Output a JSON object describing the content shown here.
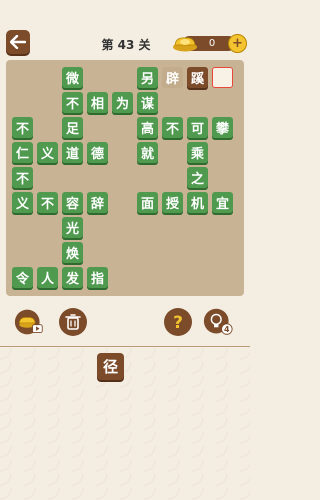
{
  "header": {
    "title": "第 43 关",
    "coin_count": "0",
    "plus_label": "+"
  },
  "board": {
    "cells": [
      {
        "ch": "微",
        "col": 2,
        "row": 0,
        "style": "green"
      },
      {
        "ch": "另",
        "col": 5,
        "row": 0,
        "style": "green"
      },
      {
        "ch": "辟",
        "col": 6,
        "row": 0,
        "style": "tan"
      },
      {
        "ch": "蹊",
        "col": 7,
        "row": 0,
        "style": "brown"
      },
      {
        "ch": "",
        "col": 8,
        "row": 0,
        "style": "empty-target"
      },
      {
        "ch": "不",
        "col": 2,
        "row": 1,
        "style": "green"
      },
      {
        "ch": "相",
        "col": 3,
        "row": 1,
        "style": "green"
      },
      {
        "ch": "为",
        "col": 4,
        "row": 1,
        "style": "green"
      },
      {
        "ch": "谋",
        "col": 5,
        "row": 1,
        "style": "green"
      },
      {
        "ch": "不",
        "col": 0,
        "row": 2,
        "style": "green"
      },
      {
        "ch": "足",
        "col": 2,
        "row": 2,
        "style": "green"
      },
      {
        "ch": "高",
        "col": 5,
        "row": 2,
        "style": "green"
      },
      {
        "ch": "不",
        "col": 6,
        "row": 2,
        "style": "green"
      },
      {
        "ch": "可",
        "col": 7,
        "row": 2,
        "style": "green"
      },
      {
        "ch": "攀",
        "col": 8,
        "row": 2,
        "style": "green"
      },
      {
        "ch": "仁",
        "col": 0,
        "row": 3,
        "style": "green"
      },
      {
        "ch": "义",
        "col": 1,
        "row": 3,
        "style": "green"
      },
      {
        "ch": "道",
        "col": 2,
        "row": 3,
        "style": "green"
      },
      {
        "ch": "德",
        "col": 3,
        "row": 3,
        "style": "green"
      },
      {
        "ch": "就",
        "col": 5,
        "row": 3,
        "style": "green"
      },
      {
        "ch": "乘",
        "col": 7,
        "row": 3,
        "style": "green"
      },
      {
        "ch": "不",
        "col": 0,
        "row": 4,
        "style": "green"
      },
      {
        "ch": "之",
        "col": 7,
        "row": 4,
        "style": "green"
      },
      {
        "ch": "义",
        "col": 0,
        "row": 5,
        "style": "green"
      },
      {
        "ch": "不",
        "col": 1,
        "row": 5,
        "style": "green"
      },
      {
        "ch": "容",
        "col": 2,
        "row": 5,
        "style": "green"
      },
      {
        "ch": "辞",
        "col": 3,
        "row": 5,
        "style": "green"
      },
      {
        "ch": "面",
        "col": 5,
        "row": 5,
        "style": "green"
      },
      {
        "ch": "授",
        "col": 6,
        "row": 5,
        "style": "green"
      },
      {
        "ch": "机",
        "col": 7,
        "row": 5,
        "style": "green"
      },
      {
        "ch": "宜",
        "col": 8,
        "row": 5,
        "style": "green"
      },
      {
        "ch": "光",
        "col": 2,
        "row": 6,
        "style": "green"
      },
      {
        "ch": "焕",
        "col": 2,
        "row": 7,
        "style": "green"
      },
      {
        "ch": "令",
        "col": 0,
        "row": 8,
        "style": "green"
      },
      {
        "ch": "人",
        "col": 1,
        "row": 8,
        "style": "green"
      },
      {
        "ch": "发",
        "col": 2,
        "row": 8,
        "style": "green"
      },
      {
        "ch": "指",
        "col": 3,
        "row": 8,
        "style": "green"
      }
    ]
  },
  "tools": {
    "hint_count": "4"
  },
  "answer": {
    "tile": "径"
  },
  "colors": {
    "green": "#4f9a4f",
    "brown": "#7b4b2a",
    "tan": "#c2ac8b",
    "highlight": "#e8473b",
    "gold": "#f4c430"
  }
}
